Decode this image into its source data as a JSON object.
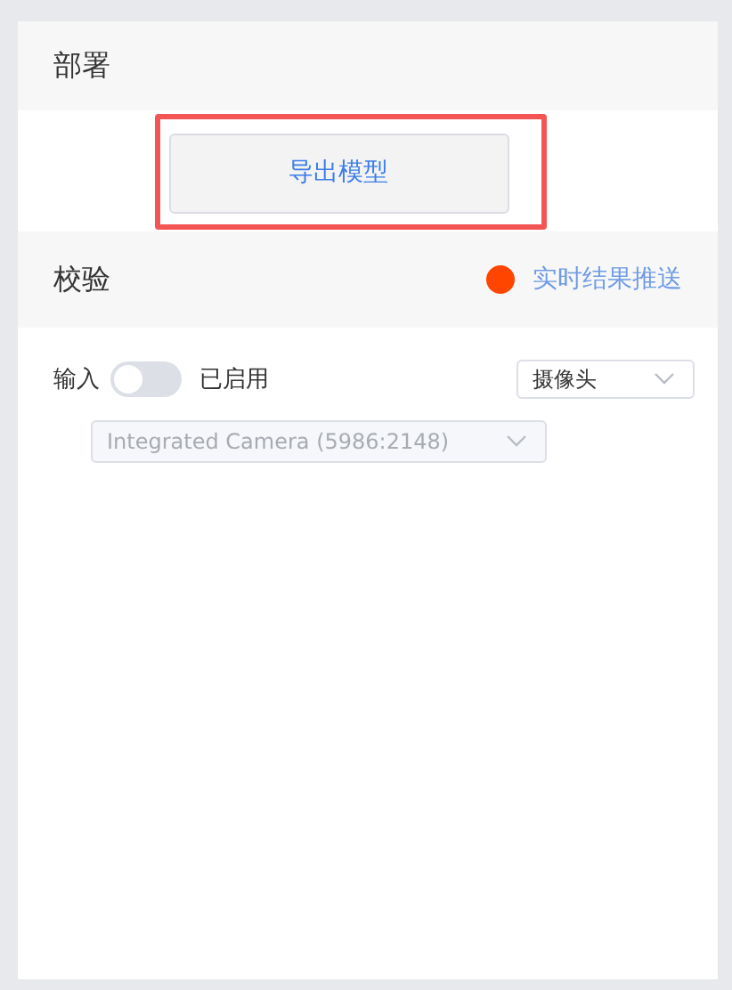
{
  "deploy": {
    "title": "部署",
    "export_button": {
      "label": "导出模型",
      "highlighted": true
    }
  },
  "verify": {
    "title": "校验",
    "push_status": {
      "color": "#ff4500",
      "label": "实时结果推送"
    },
    "input": {
      "label": "输入",
      "toggle": {
        "on": false
      },
      "toggle_label": "已启用"
    },
    "source_select": {
      "value": "摄像头"
    },
    "camera_select": {
      "value": "Integrated Camera (5986:2148)",
      "disabled": true
    }
  }
}
